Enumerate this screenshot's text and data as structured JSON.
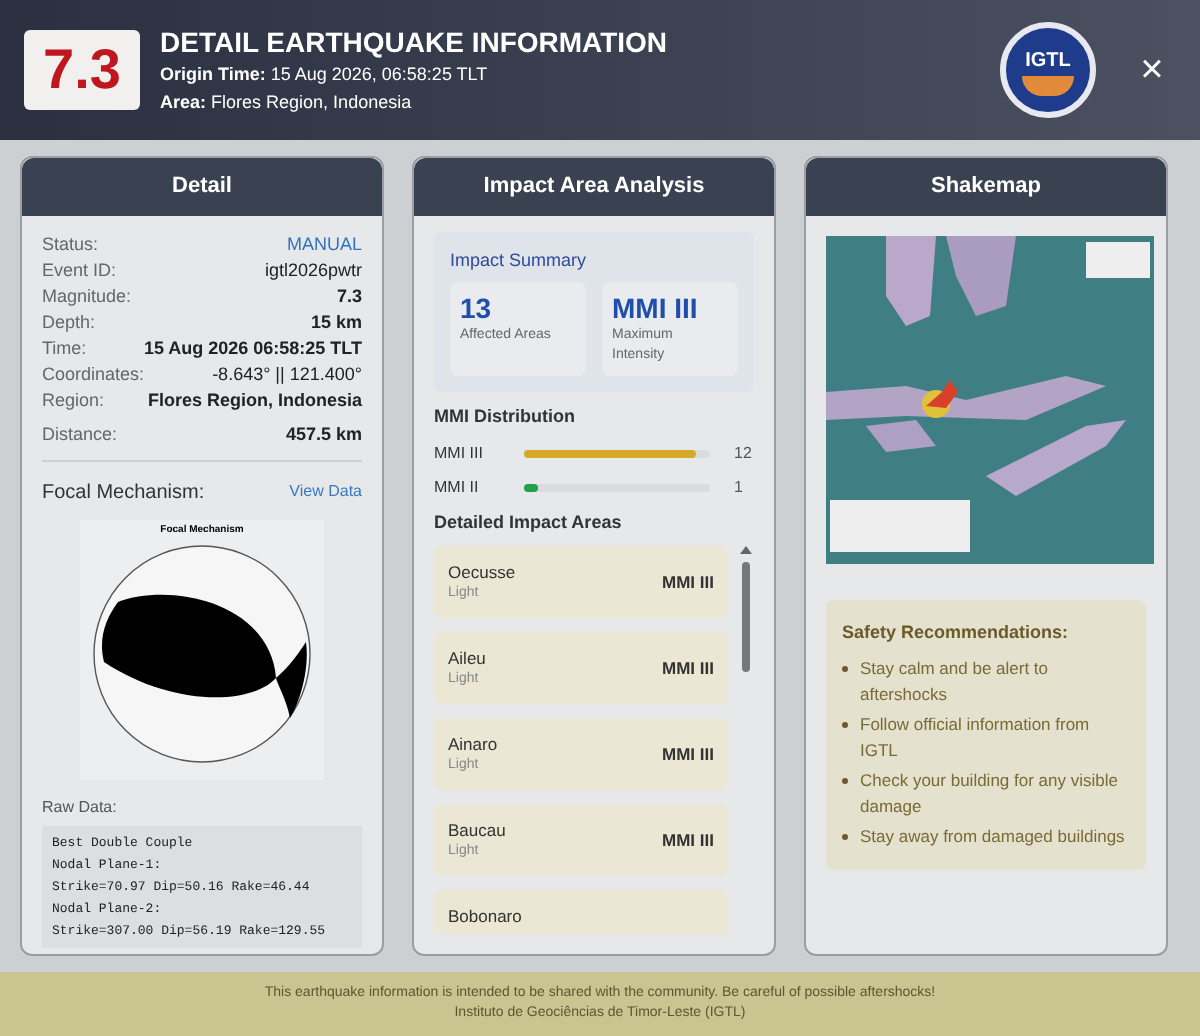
{
  "header": {
    "magnitude": "7.3",
    "title": "DETAIL EARTHQUAKE INFORMATION",
    "origin_label": "Origin Time:",
    "origin_value": "15 Aug 2026, 06:58:25 TLT",
    "area_label": "Area:",
    "area_value": "Flores Region, Indonesia",
    "logo_text": "IGTL",
    "close": "×"
  },
  "detail": {
    "title": "Detail",
    "rows": [
      {
        "label": "Status:",
        "value": "MANUAL",
        "kind": "status"
      },
      {
        "label": "Event ID:",
        "value": "igtl2026pwtr",
        "kind": "plain"
      },
      {
        "label": "Magnitude:",
        "value": "7.3",
        "kind": "bold"
      },
      {
        "label": "Depth:",
        "value": "15 km",
        "kind": "bold"
      },
      {
        "label": "Time:",
        "value": "15 Aug 2026 06:58:25 TLT",
        "kind": "bold"
      },
      {
        "label": "Coordinates:",
        "value": "-8.643° || 121.400°",
        "kind": "plain"
      },
      {
        "label": "Region:",
        "value": "Flores Region, Indonesia",
        "kind": "bold"
      }
    ],
    "distance_label": "Distance:",
    "distance_value": "457.5 km",
    "focal_label": "Focal Mechanism:",
    "view_data": "View Data",
    "focal_title": "Focal Mechanism",
    "raw_label": "Raw Data:",
    "raw_lines": [
      "Best Double Couple",
      "Nodal Plane-1:",
      "Strike=70.97 Dip=50.16 Rake=46.44",
      "Nodal Plane-2:",
      "Strike=307.00 Dip=56.19 Rake=129.55"
    ]
  },
  "impact": {
    "title": "Impact Area Analysis",
    "summary_title": "Impact Summary",
    "stats": [
      {
        "value": "13",
        "label": "Affected Areas"
      },
      {
        "value": "MMI III",
        "label": "Maximum Intensity"
      }
    ],
    "distribution_title": "MMI Distribution",
    "distribution": [
      {
        "label": "MMI III",
        "count": "12",
        "level": 0.93,
        "color": "#d6a92a"
      },
      {
        "label": "MMI II",
        "count": "1",
        "level": 0.07,
        "color": "#22a04b"
      }
    ],
    "areas_title": "Detailed Impact Areas",
    "areas": [
      {
        "name": "Oecusse",
        "level_text": "Light",
        "mmi": "MMI III"
      },
      {
        "name": "Aileu",
        "level_text": "Light",
        "mmi": "MMI III"
      },
      {
        "name": "Ainaro",
        "level_text": "Light",
        "mmi": "MMI III"
      },
      {
        "name": "Baucau",
        "level_text": "Light",
        "mmi": "MMI III"
      },
      {
        "name": "Bobonaro"
      }
    ]
  },
  "shakemap": {
    "title": "Shakemap",
    "safety_title": "Safety Recommendations:",
    "recommendations": [
      "Stay calm and be alert to aftershocks",
      "Follow official information from IGTL",
      "Check your building for any visible damage",
      "Stay away from damaged buildings"
    ]
  },
  "footer": {
    "line_1": "This earthquake information is intended to be shared with the community. Be careful of possible aftershocks!",
    "line_2": "Instituto de Geociências de Timor-Leste (IGTL)"
  }
}
